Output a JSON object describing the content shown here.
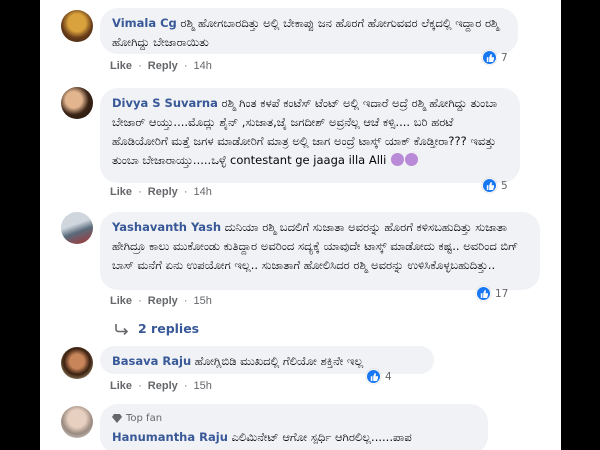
{
  "comments": [
    {
      "name": "Vimala Cg",
      "text": "ರಶ್ಮಿ ಹೋಗಬಾರದಿತ್ತು ಅಲ್ಲಿ ಬೇಕಾಪ್ಪು ಜನ ಹೊರಗೆ ಹೋಗುವವರ ಲೆಕ್ಕದಲ್ಲಿ ಇದ್ದಾರ ರಶ್ಮಿ ಹೋಗಿದ್ದು ಬೇಜಾರಾಯಿತು",
      "like": "Like",
      "reply": "Reply",
      "time": "14h",
      "reactions": "7"
    },
    {
      "name": "Divya S Suvarna",
      "text": "ರಶ್ಮಿ ಗಿಂತ ಕಳಪೆ ಕಂಟೆಸ್ ಟೆಂಟ್ ಅಲ್ಲಿ ಇದಾರೆ ಅದ್ರೆ ರಶ್ಮಿ ಹೋಗಿದ್ದು ತುಂಬಾ ಬೇಜಾರ್ ಆಯ್ತು....ಮೊದ್ಲು ಶೈನ್ ,ಸುಜಾತ,ಜೈ ಜಗದೀಶ್ ಅವ್ರನೆಲ್ಲ ಆಚೆ ಕಳ್ಸಿ.... ಬರಿ ಹರಟೆ ಹೊಡಿಯೋರಿಗೆ ಮತ್ತೆ ಜಗಳ ಮಾಡೋರಿಗೆ ಮಾತ್ರ ಅಲ್ಲಿ ಜಾಗ ಅಂದ್ರೆ ಟಾಸ್ಕ್ ಯಾಕ್ ಕೊಡ್ತೀರಾ??? ಇವತ್ತು ತುಂಬಾ ಬೇಜಾರಾಯ್ತು.....ಒಳ್ಳೆ contestant ge jaaga illa Alli",
      "like": "Like",
      "reply": "Reply",
      "time": "14h",
      "reactions": "5"
    },
    {
      "name": "Yashavanth Yash",
      "text": "ದುನಿಯಾ ರಶ್ಮಿ ಬದಲಿಗೆ ಸುಜಾತಾ ಅವರನ್ನು ಹೊರಗೆ ಕಳಿಸಬಹುದಿತ್ತು ಸುಜಾತಾ ಹೇಗಿದ್ರೂ ಕಾಲು ಮುಕೋಂಡು ಕುತಿದ್ದಾರ ಅವರಿಂದ ಸದ್ಯಕ್ಕೆ ಯಾವುದೇ ಟಾಸ್ಕ್ ಮಾಡೋದು ಕಷ್ಟ.. ಅವರಿಂದ ಬಿಗ್ ಬಾಸ್ ಮನೆಗೆ ಏನು ಉಪಯೋಗ ಇಲ್ಲ.. ಸುಜಾತಾಗೆ ಹೋಲಿಸಿದರ ರಶ್ಮಿ ಅವರನ್ನು ಉಳಿಸಿಕೊಳ್ಳಬಹುದಿತ್ತು..",
      "like": "Like",
      "reply": "Reply",
      "time": "15h",
      "reactions": "17",
      "replies": "2 replies"
    },
    {
      "name": "Basava Raju",
      "text": "ಹೋಗ್ಲಿಬಿಡಿ ಮುಖದಲ್ಲಿ ಗೆಲಿಯೋ ಶಕ್ತಿನೇ ಇಲ್ಲ",
      "like": "Like",
      "reply": "Reply",
      "time": "15h",
      "reactions": "4"
    },
    {
      "badge": "Top fan",
      "name": "Hanumantha Raju",
      "text": "ಎಲಿಮಿನೇಟ್ ಆಗೋ ಸ್ಪರ್ಧಿ ಆಗಿರಲಿಲ್ಲ......ಪಾಪ"
    }
  ],
  "colors": {
    "name": "#385898",
    "bubble": "#f0f2f5",
    "like": "#1877f2",
    "meta": "#65676b"
  },
  "icons": [
    "thumbs-up-icon",
    "reply-arrow-icon",
    "diamond-icon"
  ]
}
